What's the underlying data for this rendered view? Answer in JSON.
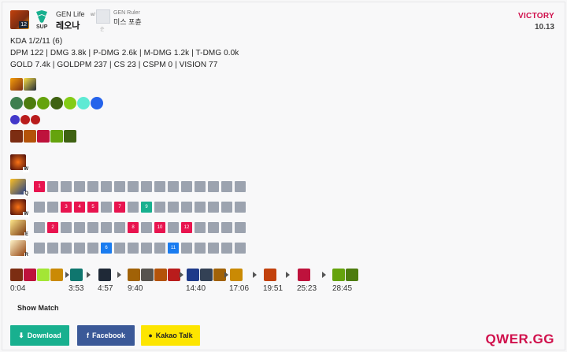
{
  "header": {
    "champion_level": "12",
    "role": "SUP",
    "player_team": "GEN Life",
    "player_name": "레오나",
    "versus": "w/",
    "opponent_team": "GEN Ruler",
    "opponent_name": "미스 포츈",
    "opponent_sub": "순",
    "result": "VICTORY",
    "patch": "10.13"
  },
  "stats": {
    "kda": "KDA 1/2/11 (6)",
    "damage": "DPM 122 | DMG 3.8k | P-DMG 2.6k | M-DMG 1.2k | T-DMG 0.0k",
    "economy": "GOLD 7.4k | GOLDPM 237 | CS 23 | CSPM 0 | VISION 77"
  },
  "skills": [
    {
      "key": "Q",
      "levels": [
        "1",
        "",
        "",
        "",
        "",
        "",
        "",
        "",
        "",
        "",
        "",
        "",
        "",
        "",
        "",
        ""
      ],
      "filled": [
        0
      ]
    },
    {
      "key": "W",
      "levels": [
        "",
        "",
        "3",
        "4",
        "5",
        "",
        "7",
        "",
        "9",
        "",
        "",
        "",
        "",
        "",
        "",
        ""
      ],
      "filled": [
        2,
        3,
        4,
        6,
        8
      ]
    },
    {
      "key": "E",
      "levels": [
        "",
        "2",
        "",
        "",
        "",
        "",
        "",
        "8",
        "",
        "10",
        "",
        "12",
        "",
        "",
        "",
        ""
      ],
      "filled": [
        1,
        7,
        9,
        11
      ]
    },
    {
      "key": "R",
      "levels": [
        "",
        "",
        "",
        "",
        "",
        "6",
        "",
        "",
        "",
        "",
        "11",
        "",
        "",
        "",
        "",
        ""
      ],
      "filled": [
        5,
        10
      ]
    }
  ],
  "build": {
    "times": [
      "0:04",
      "3:53",
      "4:57",
      "9:40",
      "14:40",
      "17:06",
      "19:51",
      "25:23",
      "28:45"
    ]
  },
  "actions": {
    "show_match": "Show Match",
    "download": "Download",
    "facebook": "Facebook",
    "kakao": "Kakao Talk"
  },
  "brand": "QWER.GG",
  "colors": {
    "accent": "#d0104c",
    "skill_active": "#e8144f",
    "ultimate": "#1a7cf0",
    "teal": "#18b08f",
    "facebook": "#3b5998",
    "kakao": "#fde500"
  }
}
